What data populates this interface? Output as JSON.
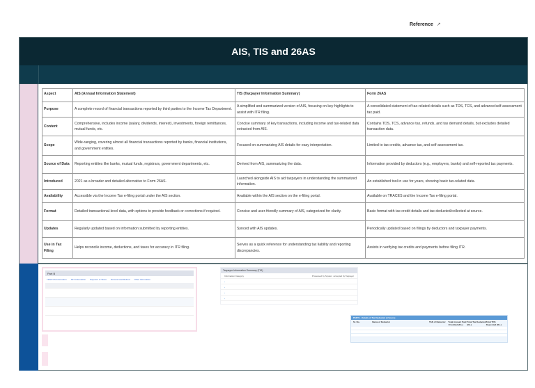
{
  "reference": {
    "label": "Reference",
    "icon": "external-link-icon"
  },
  "title": "AIS, TIS and 26AS",
  "table": {
    "headers": [
      "Aspect",
      "AIS (Annual Information Statement)",
      "TIS (Taxpayer Information Summary)",
      "Form 26AS"
    ],
    "rows": [
      [
        "Purpose",
        "A complete record of financial transactions reported by third parties to the Income Tax Department.",
        "A simplified and summarized version of AIS, focusing on key highlights to assist with ITR filing.",
        "A consolidated statement of tax-related details such as TDS, TCS, and advance/self-assessment tax paid."
      ],
      [
        "Content",
        "Comprehensive, includes income (salary, dividends, interest), investments, foreign remittances, mutual funds, etc.",
        "Concise summary of key transactions, including income and tax-related data extracted from AIS.",
        "Contains TDS, TCS, advance tax, refunds, and tax demand details, but excludes detailed transaction data."
      ],
      [
        "Scope",
        "Wide-ranging, covering almost all financial transactions reported by banks, financial institutions, and government entities.",
        "Focused on summarizing AIS details for easy interpretation.",
        "Limited to tax credits, advance tax, and self-assessment tax."
      ],
      [
        "Source of Data",
        "Reporting entities like banks, mutual funds, registrars, government departments, etc.",
        "Derived from AIS, summarizing the data.",
        "Information provided by deductors (e.g., employers, banks) and self-reported tax payments."
      ],
      [
        "Introduced",
        "2021 as a broader and detailed alternative to Form 26AS.",
        "Launched alongside AIS to aid taxpayers in understanding the summarized information.",
        "An established tool in use for years, showing basic tax-related data."
      ],
      [
        "Availability",
        "Accessible via the Income Tax e-filing portal under the AIS section.",
        "Available within the AIS section on the e-filing portal.",
        "Available on TRACES and the Income Tax e-filing portal."
      ],
      [
        "Format",
        "Detailed transactional-level data, with options to provide feedback or corrections if required.",
        "Concise and user-friendly summary of AIS, categorized for clarity.",
        "Basic format with tax credit details and tax deducted/collected at source."
      ],
      [
        "Updates",
        "Regularly updated based on information submitted by reporting entities.",
        "Synced with AIS updates.",
        "Periodically updated based on filings by deductors and taxpayer payments."
      ],
      [
        "Use in Tax Filing",
        "Helps reconcile income, deductions, and taxes for accuracy in ITR filing.",
        "Serves as a quick reference for understanding tax liability and reporting discrepancies.",
        "Assists in verifying tax credits and payments before filing ITR."
      ]
    ]
  },
  "screens": {
    "ais": {
      "title": "Part B",
      "tabs": [
        "TDS/TCS Information",
        "SFT Information",
        "Payment of Taxes",
        "Demand and Refund",
        "Other Information"
      ]
    },
    "tis": {
      "title": "Taxpayer Information Summary (TIS)",
      "header": [
        "Information Category",
        "Processed by System",
        "Accepted by Taxpayer"
      ]
    },
    "tds": {
      "title": "PART-I - Details of Tax Deducted at Source",
      "header": [
        "Sr. No.",
        "Name of Deductor",
        "TAN of Deductor",
        "Total Amount Paid / Credited (Rs.)",
        "Total Tax Deducted (Rs.)",
        "Total TDS Deposited (Rs.)"
      ]
    }
  }
}
